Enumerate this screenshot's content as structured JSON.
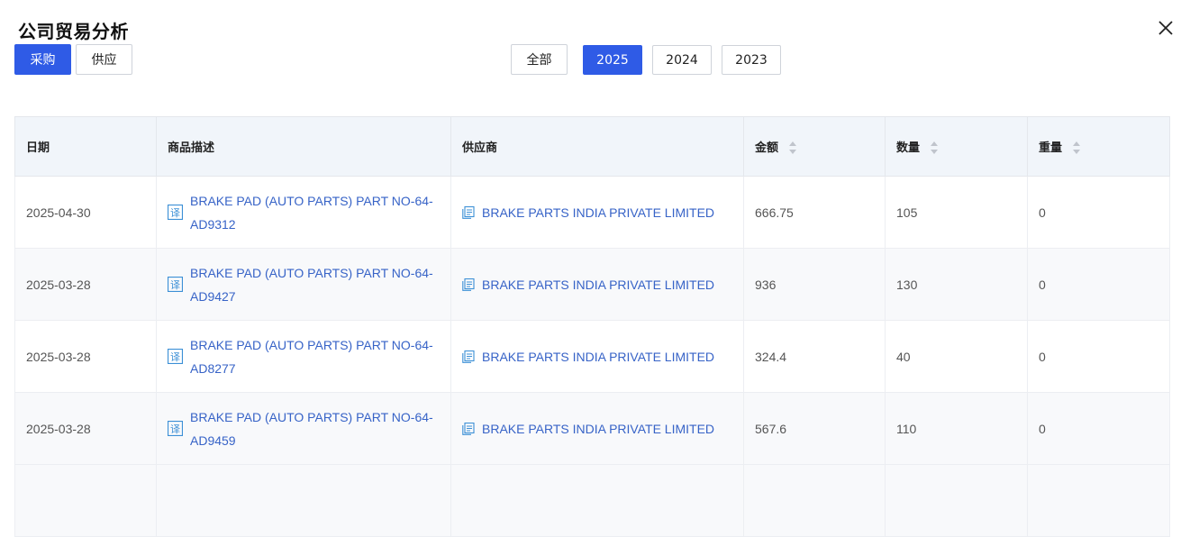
{
  "dialog": {
    "title": "公司贸易分析"
  },
  "type_tabs": [
    {
      "label": "采购",
      "active": true
    },
    {
      "label": "供应",
      "active": false
    }
  ],
  "year_tabs": [
    {
      "label": "全部",
      "active": false
    },
    {
      "label": "2025",
      "active": true
    },
    {
      "label": "2024",
      "active": false
    },
    {
      "label": "2023",
      "active": false
    }
  ],
  "table": {
    "columns": [
      "日期",
      "商品描述",
      "供应商",
      "金额",
      "数量",
      "重量"
    ],
    "rows": [
      {
        "date": "2025-04-30",
        "desc": "BRAKE PAD (AUTO PARTS) PART NO-64-AD9312",
        "supplier": "BRAKE PARTS INDIA PRIVATE LIMITED",
        "amount": "666.75",
        "qty": "105",
        "weight": "0"
      },
      {
        "date": "2025-03-28",
        "desc": "BRAKE PAD (AUTO PARTS) PART NO-64-AD9427",
        "supplier": "BRAKE PARTS INDIA PRIVATE LIMITED",
        "amount": "936",
        "qty": "130",
        "weight": "0"
      },
      {
        "date": "2025-03-28",
        "desc": "BRAKE PAD (AUTO PARTS) PART NO-64-AD8277",
        "supplier": "BRAKE PARTS INDIA PRIVATE LIMITED",
        "amount": "324.4",
        "qty": "40",
        "weight": "0"
      },
      {
        "date": "2025-03-28",
        "desc": "BRAKE PAD (AUTO PARTS) PART NO-64-AD9459",
        "supplier": "BRAKE PARTS INDIA PRIVATE LIMITED",
        "amount": "567.6",
        "qty": "110",
        "weight": "0"
      }
    ]
  },
  "colors": {
    "accent": "#2f5be6",
    "link": "#3763c7",
    "header_bg": "#f1f5fa"
  },
  "icons": {
    "translate": "translate-icon",
    "company": "company-icon",
    "sort": "sort-icon",
    "close": "close-icon"
  }
}
